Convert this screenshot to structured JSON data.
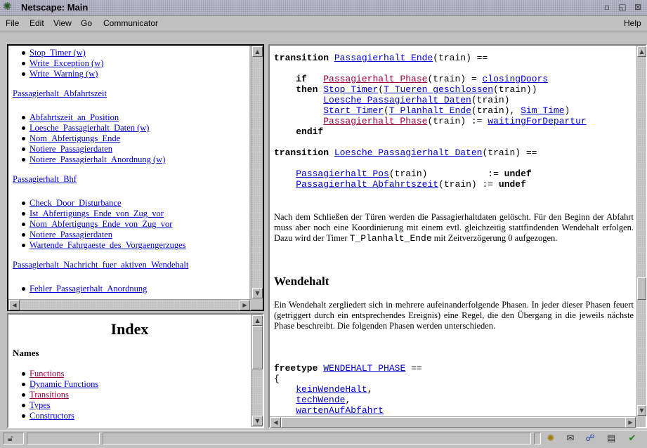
{
  "window": {
    "title": "Netscape: Main"
  },
  "menubar": {
    "items": [
      "File",
      "Edit",
      "View",
      "Go",
      "Communicator"
    ],
    "help": "Help"
  },
  "toc": {
    "group1": [
      "Stop_Timer (w)",
      "Write_Exception (w)",
      "Write_Warning (w)"
    ],
    "section2": "Passagierhalt_Abfahrtszeit",
    "group2": [
      "Abfahrtszeit_an_Position",
      "Loesche_Passagierhalt_Daten (w)",
      "Nom_Abfertigungs_Ende",
      "Notiere_Passagierdaten",
      "Notiere_Passagierhalt_Anordnung (w)"
    ],
    "section3": "Passagierhalt_Bhf",
    "group3": [
      "Check_Door_Disturbance",
      "Ist_Abfertigungs_Ende_von_Zug_vor",
      "Nom_Abfertigungs_Ende_von_Zug_vor",
      "Notiere_Passagierdaten",
      "Wartende_Fahrgaeste_des_Vorgaengerzuges"
    ],
    "section4": "Passagierhalt_Nachricht_fuer_aktiven_Wendehalt",
    "group4": [
      "Fehler_Passagierhalt_Anordnung"
    ]
  },
  "index": {
    "title": "Index",
    "names_heading": "Names",
    "links": [
      "Functions",
      "Dynamic Functions",
      "Transitions",
      "Types",
      "Constructors"
    ]
  },
  "main": {
    "t1": {
      "kw_transition": "transition",
      "name": "Passagierhalt_Ende",
      "sig_rest": "(train) ==",
      "kw_if": "if",
      "cond_fn": "Passagierhalt_Phase",
      "cond_mid": "(train) = ",
      "cond_val": "closingDoors",
      "kw_then": "then",
      "stop_timer": "Stop_Timer",
      "paren_open": "(",
      "t_tueren": "T_Tueren_geschlossen",
      "tueren_rest": "(train))",
      "loesche": "Loesche_Passagierhalt_Daten",
      "loesche_rest": "(train)",
      "start_timer": "Start_Timer",
      "t_planhalt": "T_Planhalt_Ende",
      "planhalt_rest": "(train), ",
      "sim_time": "Sim_Time",
      "close_paren": ")",
      "phase": "Passagierhalt_Phase",
      "phase_rest": "(train) := ",
      "waiting": "waitingForDepartur",
      "kw_endif": "endif"
    },
    "t2": {
      "kw_transition": "transition",
      "name": "Loesche_Passagierhalt_Daten",
      "sig_rest": "(train) ==",
      "pos": "Passagierhalt_Pos",
      "pos_rest": "(train)           := ",
      "abf": "Passagierhalt_Abfahrtszeit",
      "abf_rest": "(train) := ",
      "kw_undef": "undef"
    },
    "para1_a": "Nach dem Schließen der Türen werden die Passagierhaltdaten gelöscht. Für den Beginn der Abfahrt muss aber noch eine Koordinierung mit einem evtl. gleichzeitig stattfindenden Wendehalt erfolgen. Dazu wird der Timer ",
    "para1_code": "T_Planhalt_Ende",
    "para1_b": " mit Zeitverzögerung 0 aufgezogen.",
    "heading": "Wendehalt",
    "para2": "Ein Wendehalt zergliedert sich in mehrere aufeinanderfolgende Phasen. In jeder dieser Phasen feuert (getriggert durch ein entsprechendes Ereignis) eine Regel, die den Übergang in die jeweils nächste Phase beschreibt. Die folgenden Phasen werden unterschieden.",
    "freetype": {
      "kw": "freetype",
      "name": "WENDEHALT_PHASE",
      "rest": " ==",
      "brace": "{",
      "items": [
        "keinWendeHalt",
        "techWende",
        "wartenAufAbfahrt"
      ],
      "comma": ","
    }
  },
  "status": {
    "icons": [
      "lock-icon",
      "netscape-icon",
      "mail-icon",
      "discussion-icon",
      "composer-icon",
      "bookmark-check-icon"
    ]
  },
  "colors": {
    "link": "#0000cc",
    "visited": "#99003a",
    "chrome": "#c0c0c0"
  }
}
